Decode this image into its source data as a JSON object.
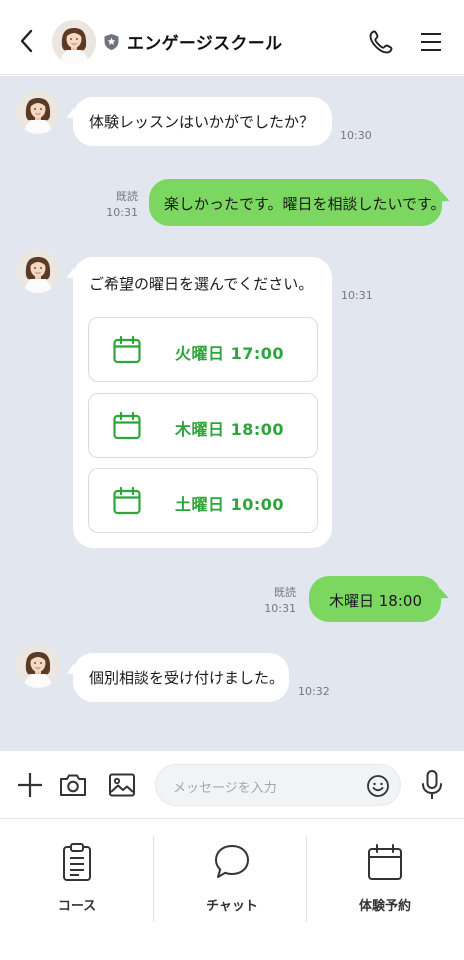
{
  "header": {
    "title": "エンゲージスクール",
    "back_icon": "chevron-left-icon",
    "verified_icon": "shield-icon",
    "call_icon": "phone-icon",
    "menu_icon": "hamburger-menu-icon"
  },
  "chat": {
    "messages": [
      {
        "from": "school",
        "text": "体験レッスンはいかがでしたか？",
        "time": "10:30"
      },
      {
        "from": "me",
        "text": "楽しかったです。曜日を相談したいです。",
        "read": "既読",
        "time": "10:31"
      },
      {
        "from": "school",
        "text": "ご希望の曜日を選んでください。",
        "time": "10:31",
        "options": [
          "火曜日 17:00",
          "木曜日 18:00",
          "土曜日 10:00"
        ]
      },
      {
        "from": "me",
        "text": "木曜日 18:00",
        "read": "既読",
        "time": "10:31"
      },
      {
        "from": "school",
        "text": "個別相談を受け付けました。",
        "time": "10:32"
      }
    ]
  },
  "input": {
    "placeholder": "メッセージを入力",
    "plus_icon": "plus-icon",
    "camera_icon": "camera-icon",
    "image_icon": "image-icon",
    "emoji_icon": "smile-icon",
    "mic_icon": "microphone-icon"
  },
  "nav": {
    "items": [
      {
        "label": "コース",
        "icon": "clipboard-icon"
      },
      {
        "label": "チャット",
        "icon": "chat-bubble-icon"
      },
      {
        "label": "体験予約",
        "icon": "calendar-icon"
      }
    ]
  },
  "colors": {
    "accent_green": "#2ea53a",
    "sent_bubble": "#7bd760",
    "chat_background": "#e1e6ef"
  }
}
